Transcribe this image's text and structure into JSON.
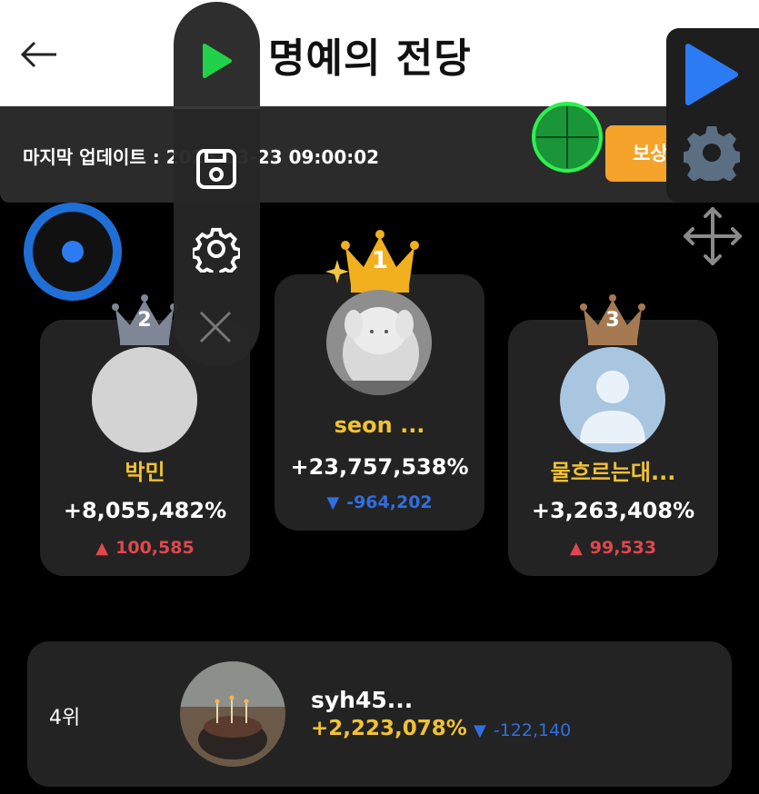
{
  "header": {
    "title": "명예의 전당",
    "back_icon": "arrow-left-icon"
  },
  "info": {
    "update_text": "마지막 업데이트 : 2025-03-23 09:00:02",
    "reward_button": "보상 안내"
  },
  "overlay": {
    "icons": [
      "play-icon",
      "save-icon",
      "gear-icon",
      "close-icon",
      "crosshair-icon",
      "move-icon",
      "record-icon"
    ]
  },
  "podium": [
    {
      "rank": "1",
      "name": "seon ...",
      "percent": "+23,757,538%",
      "delta": "-964,202",
      "direction": "down"
    },
    {
      "rank": "2",
      "name": "박민",
      "percent": "+8,055,482%",
      "delta": "100,585",
      "direction": "up"
    },
    {
      "rank": "3",
      "name": "물흐르는대...",
      "percent": "+3,263,408%",
      "delta": "99,533",
      "direction": "up"
    }
  ],
  "list": [
    {
      "rank_label": "4위",
      "name": "syh45...",
      "percent": "+2,223,078%",
      "delta": "-122,140",
      "direction": "down"
    }
  ],
  "colors": {
    "gold": "#f2c230",
    "silver": "#7d8796",
    "bronze": "#a57a53",
    "up": "#e0474c",
    "down": "#2f6fe0",
    "reward": "#f5a32a",
    "play_green": "#22d14a",
    "play_blue": "#2c7bf2"
  }
}
